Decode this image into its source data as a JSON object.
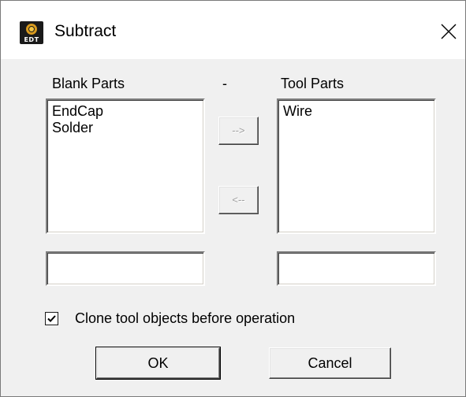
{
  "window": {
    "title": "Subtract",
    "icon_label": "EDT"
  },
  "blank_parts": {
    "label": "Blank Parts",
    "items": [
      "EndCap",
      "Solder"
    ],
    "input_value": ""
  },
  "separator": "-",
  "tool_parts": {
    "label": "Tool Parts",
    "items": [
      "Wire"
    ],
    "input_value": ""
  },
  "buttons": {
    "move_right": "-->",
    "move_left": "<--",
    "ok": "OK",
    "cancel": "Cancel"
  },
  "options": {
    "clone_label": "Clone tool objects before operation",
    "clone_checked": true
  },
  "icons": {
    "app": "edt-app-icon",
    "close": "close-icon",
    "check": "checkmark-icon"
  }
}
